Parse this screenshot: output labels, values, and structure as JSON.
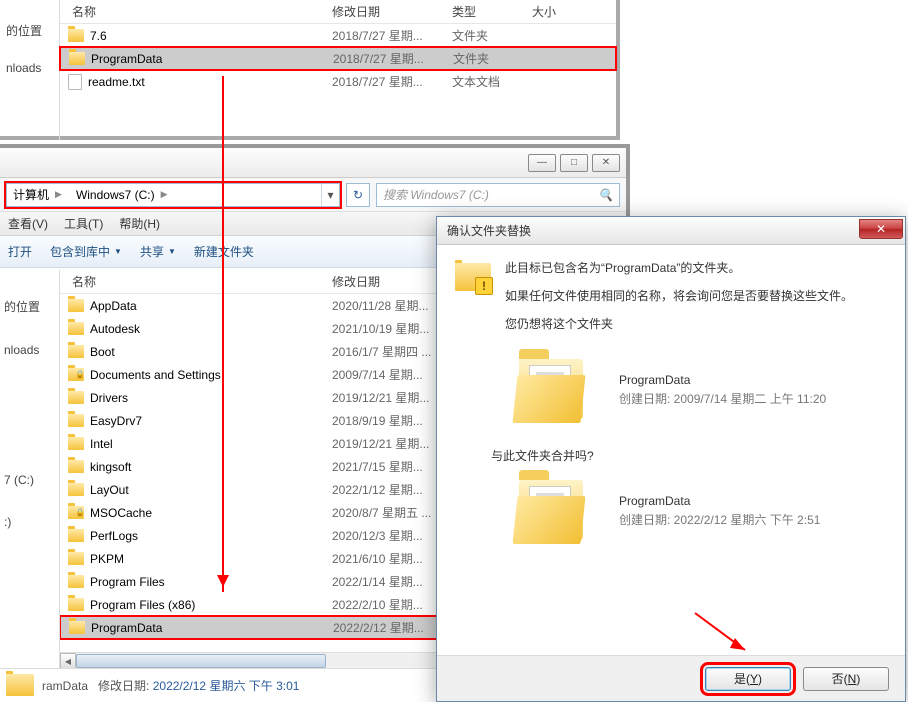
{
  "topExplorer": {
    "columns": {
      "name": "名称",
      "date": "修改日期",
      "type": "类型",
      "size": "大小"
    },
    "sideLabels": [
      "的位置",
      "",
      "nloads"
    ],
    "rows": [
      {
        "icon": "folder",
        "name": "7.6",
        "date": "2018/7/27 星期...",
        "type": "文件夹",
        "hl": false,
        "red": false
      },
      {
        "icon": "folder",
        "name": "ProgramData",
        "date": "2018/7/27 星期...",
        "type": "文件夹",
        "hl": true,
        "red": true
      },
      {
        "icon": "file",
        "name": "readme.txt",
        "date": "2018/7/27 星期...",
        "type": "文本文档",
        "hl": false,
        "red": false
      }
    ]
  },
  "explorer2": {
    "winButtons": {
      "min": "—",
      "max": "□",
      "close": "✕"
    },
    "breadcrumb": {
      "seg1": "计算机",
      "seg2": "Windows7 (C:)"
    },
    "refreshGlyph": "↻",
    "search": {
      "placeholder": "搜索 Windows7 (C:)",
      "icon": "🔍"
    },
    "menu": {
      "view": "查看(V)",
      "tools": "工具(T)",
      "help": "帮助(H)"
    },
    "toolbar": {
      "open": "打开",
      "include": "包含到库中",
      "share": "共享",
      "new": "新建文件夹"
    },
    "columns": {
      "name": "名称",
      "date": "修改日期"
    },
    "sideLabels": [
      "的位置",
      "",
      "nloads",
      "",
      "",
      "7 (C:)",
      ":)"
    ],
    "rows": [
      {
        "icon": "folder",
        "name": "AppData",
        "date": "2020/11/28 星期..."
      },
      {
        "icon": "folder",
        "name": "Autodesk",
        "date": "2021/10/19 星期..."
      },
      {
        "icon": "folder",
        "name": "Boot",
        "date": "2016/1/7 星期四 ..."
      },
      {
        "icon": "folder-lock",
        "name": "Documents and Settings",
        "date": "2009/7/14 星期..."
      },
      {
        "icon": "folder",
        "name": "Drivers",
        "date": "2019/12/21 星期..."
      },
      {
        "icon": "folder",
        "name": "EasyDrv7",
        "date": "2018/9/19 星期..."
      },
      {
        "icon": "folder",
        "name": "Intel",
        "date": "2019/12/21 星期..."
      },
      {
        "icon": "folder",
        "name": "kingsoft",
        "date": "2021/7/15 星期..."
      },
      {
        "icon": "folder",
        "name": "LayOut",
        "date": "2022/1/12 星期..."
      },
      {
        "icon": "folder-lock",
        "name": "MSOCache",
        "date": "2020/8/7 星期五 ..."
      },
      {
        "icon": "folder",
        "name": "PerfLogs",
        "date": "2020/12/3 星期..."
      },
      {
        "icon": "folder",
        "name": "PKPM",
        "date": "2021/6/10 星期..."
      },
      {
        "icon": "folder",
        "name": "Program Files",
        "date": "2022/1/14 星期..."
      },
      {
        "icon": "folder",
        "name": "Program Files (x86)",
        "date": "2022/2/10 星期..."
      },
      {
        "icon": "folder",
        "name": "ProgramData",
        "date": "2022/2/12 星期...",
        "hl": true,
        "red": true
      }
    ],
    "status": {
      "name": "ramData",
      "dateLabel": "修改日期:",
      "dateVal": "2022/2/12 星期六 下午 3:01"
    }
  },
  "dialog": {
    "title": "确认文件夹替换",
    "closeGlyph": "✕",
    "line1_a": "此目标已包含名为“",
    "line1_b": "ProgramData",
    "line1_c": "”的文件夹。",
    "line2": "如果任何文件使用相同的名称，将会询问您是否要替换这些文件。",
    "line3": "您仍想将这个文件夹",
    "dest": {
      "name": "ProgramData",
      "meta": "创建日期: 2009/7/14 星期二 上午 11:20"
    },
    "mergeQ": "与此文件夹合并吗?",
    "src": {
      "name": "ProgramData",
      "meta": "创建日期: 2022/2/12 星期六 下午 2:51"
    },
    "yes_pre": "是(",
    "yes_key": "Y",
    "yes_post": ")",
    "no_pre": "否(",
    "no_key": "N",
    "no_post": ")"
  }
}
